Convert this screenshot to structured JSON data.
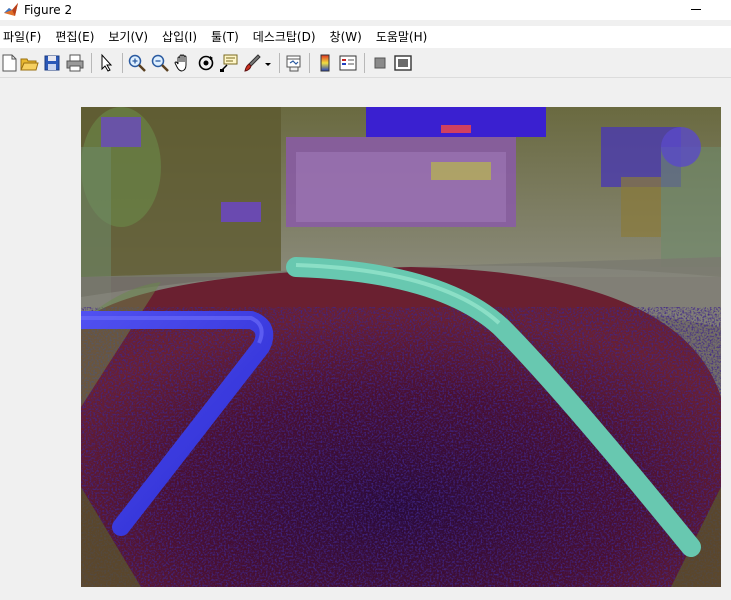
{
  "window": {
    "title": "Figure 2",
    "icon": "matlab-logo-icon"
  },
  "menu": [
    {
      "label": "파일(F)"
    },
    {
      "label": "편집(E)"
    },
    {
      "label": "보기(V)"
    },
    {
      "label": "삽입(I)"
    },
    {
      "label": "툴(T)"
    },
    {
      "label": "데스크탑(D)"
    },
    {
      "label": "창(W)"
    },
    {
      "label": "도움말(H)"
    }
  ],
  "toolbar": [
    {
      "icon": "new-figure-icon"
    },
    {
      "icon": "open-file-icon"
    },
    {
      "icon": "save-icon"
    },
    {
      "icon": "print-icon"
    },
    {
      "icon": "edit-plot-cursor-icon"
    },
    {
      "icon": "zoom-in-icon"
    },
    {
      "icon": "zoom-out-icon"
    },
    {
      "icon": "pan-hand-icon"
    },
    {
      "icon": "rotate-3d-icon"
    },
    {
      "icon": "data-cursor-icon"
    },
    {
      "icon": "brush-icon"
    },
    {
      "icon": "dropdown-arrow-icon"
    },
    {
      "icon": "link-plot-icon"
    },
    {
      "icon": "insert-colorbar-icon"
    },
    {
      "icon": "insert-legend-icon"
    },
    {
      "icon": "hide-plot-tools-icon"
    },
    {
      "icon": "show-plot-tools-icon"
    }
  ],
  "figure": {
    "content": "false-color camera image of floor with track lines",
    "colors": {
      "background": "#f0f0f0",
      "floor_dark": "#2a0a30",
      "floor_red": "#6e1a30",
      "left_line": "#3a3ae0",
      "right_line": "#6ec8b0",
      "wall": "#7a7a6a",
      "furniture_purple": "#8a5ab0",
      "blue_object": "#3a2ad0",
      "olive": "#6e6a3a"
    }
  }
}
